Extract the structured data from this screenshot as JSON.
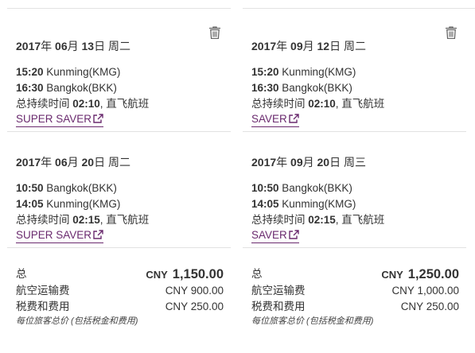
{
  "columns": [
    {
      "outbound": {
        "date_year": "2017",
        "date_year_unit": "年",
        "date_month": "06",
        "date_month_unit": "月",
        "date_day": "13",
        "date_day_unit": "日",
        "weekday": "周二",
        "dep_time": "15:20",
        "dep_place": "Kunming(KMG)",
        "arr_time": "16:30",
        "arr_place": "Bangkok(BKK)",
        "duration_label": "总持续时间",
        "duration": "02:10",
        "flight_type": ", 直飞航班",
        "fare_label": "SUPER SAVER"
      },
      "inbound": {
        "date_year": "2017",
        "date_year_unit": "年",
        "date_month": "06",
        "date_month_unit": "月",
        "date_day": "20",
        "date_day_unit": "日",
        "weekday": "周二",
        "dep_time": "10:50",
        "dep_place": "Bangkok(BKK)",
        "arr_time": "14:05",
        "arr_place": "Kunming(KMG)",
        "duration_label": "总持续时间",
        "duration": "02:15",
        "flight_type": ", 直飞航班",
        "fare_label": "SUPER SAVER"
      },
      "price": {
        "total_label": "总",
        "currency": "CNY",
        "total": "1,150.00",
        "airfare_label": "航空运输费",
        "airfare": "CNY 900.00",
        "tax_label": "税费和费用",
        "tax": "CNY 250.00",
        "note": "每位旅客总价 (包括税金和费用)"
      }
    },
    {
      "outbound": {
        "date_year": "2017",
        "date_year_unit": "年",
        "date_month": "09",
        "date_month_unit": "月",
        "date_day": "12",
        "date_day_unit": "日",
        "weekday": "周二",
        "dep_time": "15:20",
        "dep_place": "Kunming(KMG)",
        "arr_time": "16:30",
        "arr_place": "Bangkok(BKK)",
        "duration_label": "总持续时间",
        "duration": "02:10",
        "flight_type": ", 直飞航班",
        "fare_label": "SAVER"
      },
      "inbound": {
        "date_year": "2017",
        "date_year_unit": "年",
        "date_month": "09",
        "date_month_unit": "月",
        "date_day": "20",
        "date_day_unit": "日",
        "weekday": "周三",
        "dep_time": "10:50",
        "dep_place": "Bangkok(BKK)",
        "arr_time": "14:05",
        "arr_place": "Kunming(KMG)",
        "duration_label": "总持续时间",
        "duration": "02:15",
        "flight_type": ", 直飞航班",
        "fare_label": "SAVER"
      },
      "price": {
        "total_label": "总",
        "currency": "CNY",
        "total": "1,250.00",
        "airfare_label": "航空运输费",
        "airfare": "CNY 1,000.00",
        "tax_label": "税费和费用",
        "tax": "CNY 250.00",
        "note": "每位旅客总价 (包括税金和费用)"
      }
    }
  ],
  "icons": {
    "delete": "trash-icon",
    "external": "external-link-icon"
  },
  "colors": {
    "link": "#6a2a6e",
    "divider": "#e2e2e2",
    "text": "#333333"
  }
}
